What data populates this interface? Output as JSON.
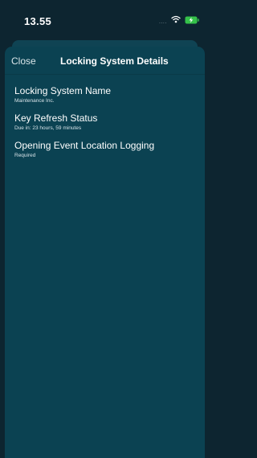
{
  "status_bar": {
    "time": "13.55",
    "signal": "....",
    "wifi_icon": "wifi-icon",
    "battery_icon": "battery-charging-icon",
    "battery_color": "#35c24a"
  },
  "nav": {
    "close_label": "Close",
    "title": "Locking System Details"
  },
  "details": [
    {
      "title": "Locking System Name",
      "value": "Maintenance Inc."
    },
    {
      "title": "Key Refresh Status",
      "value": "Due in: 23 hours, 59 minutes"
    },
    {
      "title": "Opening Event Location Logging",
      "value": "Required"
    }
  ],
  "colors": {
    "background": "#0d2530",
    "sheet": "#0b4252",
    "text": "#ffffff"
  }
}
